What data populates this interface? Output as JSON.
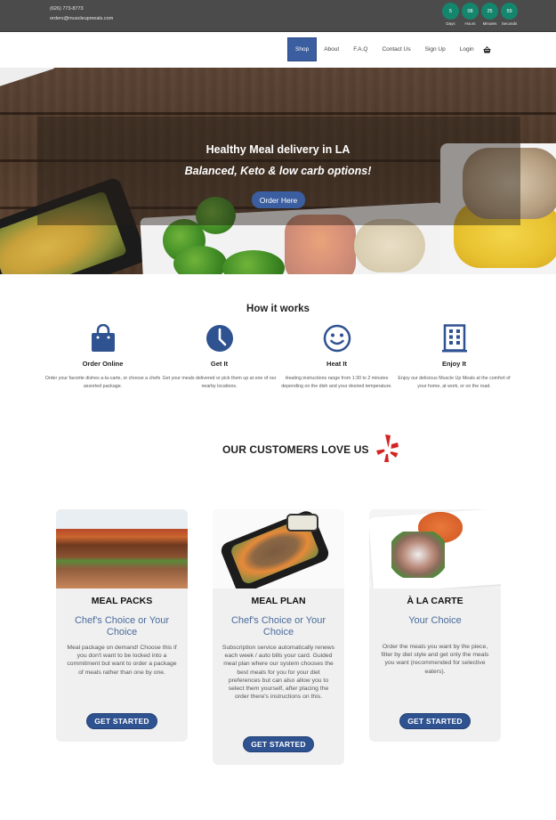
{
  "topbar": {
    "phone": "(626) 773-8773",
    "email": "orders@muscleupmeals.com",
    "countdown": [
      {
        "value": "5",
        "label": "Days"
      },
      {
        "value": "08",
        "label": "Hours"
      },
      {
        "value": "25",
        "label": "Minutes"
      },
      {
        "value": "59",
        "label": "Seconds"
      }
    ],
    "countdown_color": "#14866d"
  },
  "nav": {
    "items": [
      {
        "label": "Shop",
        "active": true
      },
      {
        "label": "About"
      },
      {
        "label": "F.A.Q"
      },
      {
        "label": "Contact Us"
      },
      {
        "label": "Sign Up"
      },
      {
        "label": "Login"
      }
    ],
    "cart_icon": "basket-icon",
    "accent": "#3b5ea0"
  },
  "hero": {
    "title": "Healthy Meal delivery in LA",
    "subtitle": "Balanced, Keto & low carb options!",
    "button": "Order Here"
  },
  "how": {
    "title": "How it works",
    "steps": [
      {
        "icon": "shopping-bag-icon",
        "title": "Order Online",
        "desc": "Order your favorite dishes a-la-carte, or choose a chefs assorted package."
      },
      {
        "icon": "clock-icon",
        "title": "Get It",
        "desc": "Get your meals delivered or pick them up at one of our nearby locations."
      },
      {
        "icon": "smiley-icon",
        "title": "Heat It",
        "desc": "Heating instructions range from 1:30 to 2 minutes depending on the dish and your desired temperature."
      },
      {
        "icon": "building-icon",
        "title": "Enjoy It",
        "desc": "Enjoy our delicious Muscle Up Meals at the comfort of your home, at work, or on the road."
      }
    ]
  },
  "customers": {
    "title": "OUR CUSTOMERS LOVE US",
    "icon": "yelp-icon"
  },
  "cards": [
    {
      "title": "MEAL PACKS",
      "subtitle": "Chef's Choice or Your Choice",
      "desc": "Meal package on demand! Choose this if you don't want to be locked into a commitment but want to order a package of meals rather than one by one.",
      "button": "GET STARTED"
    },
    {
      "title": "MEAL PLAN",
      "subtitle": "Chef's Choice or Your Choice",
      "desc": "Subscription service automatically renews each week / auto bills your card. Guided meal plan where our system chooses the best meals for you for your diet preferences but can also allow you to select them yourself, after placing the order there's instructions on this.",
      "button": "GET STARTED"
    },
    {
      "title": "À LA CARTE",
      "subtitle": "Your Choice",
      "desc": "Order the meals you want by the piece, filter by diet style and get only the meals you want (recommended for selective eaters).",
      "button": "GET STARTED"
    }
  ]
}
